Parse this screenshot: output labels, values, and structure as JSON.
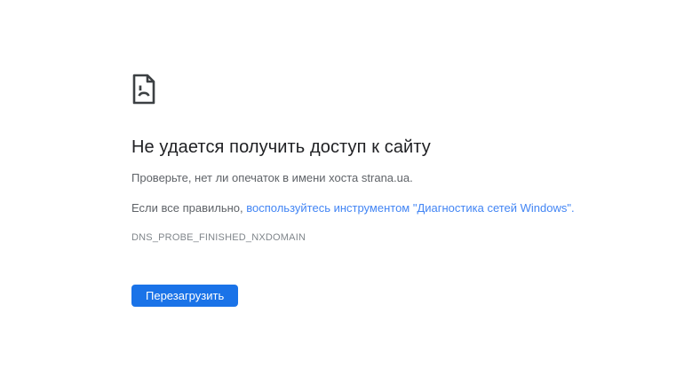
{
  "page": {
    "heading": "Не удается получить доступ к сайту",
    "line1": "Проверьте, нет ли опечаток в имени хоста strana.ua.",
    "line2_prefix": "Если все правильно, ",
    "line2_link": "воспользуйтесь инструментом \"Диагностика сетей Windows\".",
    "error_code": "DNS_PROBE_FINISHED_NXDOMAIN",
    "reload_button_label": "Перезагрузить",
    "icon": "sad-file-icon",
    "colors": {
      "heading": "#202124",
      "body": "#5f6368",
      "link": "#4285f4",
      "error_code": "#80868b",
      "button_bg": "#1a73e8",
      "button_text": "#ffffff",
      "icon": "#3c4043",
      "page_bg": "#ffffff"
    }
  }
}
